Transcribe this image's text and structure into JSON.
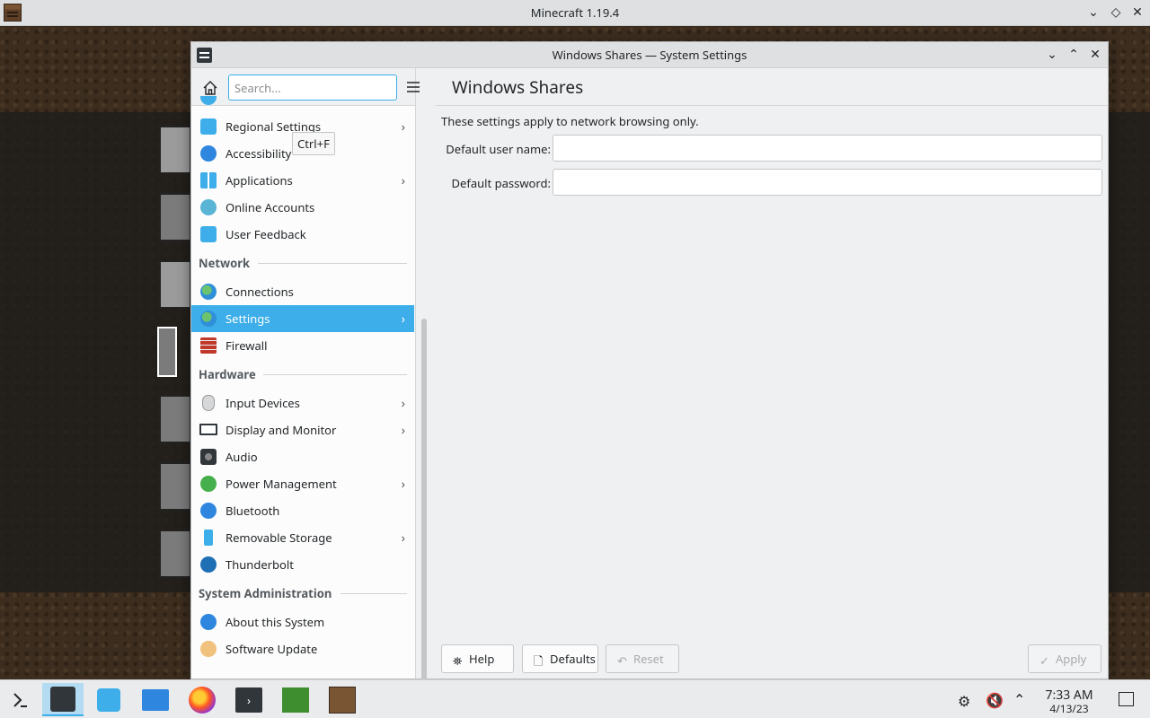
{
  "mc_window": {
    "title": "Minecraft 1.19.4"
  },
  "settings_window": {
    "title": "Windows Shares — System Settings"
  },
  "sidebar": {
    "search_placeholder": "Search...",
    "tooltip": "Ctrl+F",
    "items": [
      {
        "label": "Regional Settings",
        "icon": "regional-icon",
        "has_arrow": true
      },
      {
        "label": "Accessibility",
        "icon": "accessibility-icon",
        "has_arrow": false
      },
      {
        "label": "Applications",
        "icon": "applications-icon",
        "has_arrow": true
      },
      {
        "label": "Online Accounts",
        "icon": "online-accounts-icon",
        "has_arrow": false
      },
      {
        "label": "User Feedback",
        "icon": "feedback-icon",
        "has_arrow": false
      }
    ],
    "sections": {
      "network": "Network",
      "hardware": "Hardware",
      "sysadmin": "System Administration"
    },
    "network_items": [
      {
        "label": "Connections",
        "icon": "globe-icon"
      },
      {
        "label": "Settings",
        "icon": "globe-settings-icon",
        "active": true
      },
      {
        "label": "Firewall",
        "icon": "firewall-icon"
      }
    ],
    "hardware_items": [
      {
        "label": "Input Devices",
        "icon": "mouse-icon"
      },
      {
        "label": "Display and Monitor",
        "icon": "monitor-icon"
      },
      {
        "label": "Audio",
        "icon": "speaker-icon"
      },
      {
        "label": "Power Management",
        "icon": "power-icon"
      },
      {
        "label": "Bluetooth",
        "icon": "bluetooth-icon"
      },
      {
        "label": "Removable Storage",
        "icon": "usb-icon"
      },
      {
        "label": "Thunderbolt",
        "icon": "thunderbolt-icon"
      }
    ],
    "sysadmin_items": [
      {
        "label": "About this System",
        "icon": "info-icon"
      },
      {
        "label": "Software Update",
        "icon": "update-icon"
      }
    ]
  },
  "main": {
    "title": "Windows Shares",
    "info": "These settings apply to network browsing only.",
    "user_label": "Default user name:",
    "password_label": "Default password:",
    "user_value": "",
    "password_value": "",
    "buttons": {
      "help": "Help",
      "defaults": "Defaults",
      "reset": "Reset",
      "apply": "Apply"
    }
  },
  "taskbar": {
    "time": "7:33 AM",
    "date": "4/13/23"
  },
  "colors": {
    "accent": "#3daee9",
    "window_bg": "#eff0f1"
  }
}
